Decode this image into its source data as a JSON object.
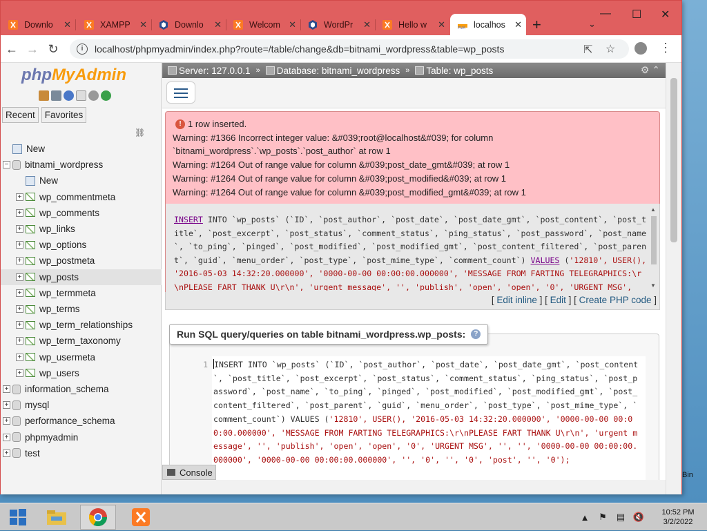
{
  "window": {
    "tabs": [
      {
        "label": "Downlo",
        "icon": "xampp-icon"
      },
      {
        "label": "XAMPP",
        "icon": "xampp-icon"
      },
      {
        "label": "Downlo",
        "icon": "bitnami-icon"
      },
      {
        "label": "Welcom",
        "icon": "xampp-icon"
      },
      {
        "label": "WordPr",
        "icon": "bitnami-icon"
      },
      {
        "label": "Hello w",
        "icon": "xampp-icon"
      },
      {
        "label": "localhos",
        "icon": "pma-icon",
        "active": true
      }
    ],
    "new_tab": "+",
    "minimize": "—",
    "maximize": "☐",
    "close": "✕"
  },
  "address": {
    "url": "localhost/phpmyadmin/index.php?route=/table/change&db=bitnami_wordpress&table=wp_posts"
  },
  "nav": {
    "logo_php": "php",
    "logo_myadmin": "MyAdmin",
    "tabs": [
      "Recent",
      "Favorites"
    ],
    "tree": [
      {
        "label": "New",
        "level": 0,
        "type": "new",
        "expander": ""
      },
      {
        "label": "bitnami_wordpress",
        "level": 0,
        "type": "db",
        "expander": "−"
      },
      {
        "label": "New",
        "level": 1,
        "type": "new",
        "expander": ""
      },
      {
        "label": "wp_commentmeta",
        "level": 1,
        "type": "table",
        "expander": "+"
      },
      {
        "label": "wp_comments",
        "level": 1,
        "type": "table",
        "expander": "+"
      },
      {
        "label": "wp_links",
        "level": 1,
        "type": "table",
        "expander": "+"
      },
      {
        "label": "wp_options",
        "level": 1,
        "type": "table",
        "expander": "+"
      },
      {
        "label": "wp_postmeta",
        "level": 1,
        "type": "table",
        "expander": "+"
      },
      {
        "label": "wp_posts",
        "level": 1,
        "type": "table",
        "expander": "+",
        "selected": true
      },
      {
        "label": "wp_termmeta",
        "level": 1,
        "type": "table",
        "expander": "+"
      },
      {
        "label": "wp_terms",
        "level": 1,
        "type": "table",
        "expander": "+"
      },
      {
        "label": "wp_term_relationships",
        "level": 1,
        "type": "table",
        "expander": "+"
      },
      {
        "label": "wp_term_taxonomy",
        "level": 1,
        "type": "table",
        "expander": "+"
      },
      {
        "label": "wp_usermeta",
        "level": 1,
        "type": "table",
        "expander": "+"
      },
      {
        "label": "wp_users",
        "level": 1,
        "type": "table",
        "expander": "+"
      },
      {
        "label": "information_schema",
        "level": 0,
        "type": "db",
        "expander": "+"
      },
      {
        "label": "mysql",
        "level": 0,
        "type": "db",
        "expander": "+"
      },
      {
        "label": "performance_schema",
        "level": 0,
        "type": "db",
        "expander": "+"
      },
      {
        "label": "phpmyadmin",
        "level": 0,
        "type": "db",
        "expander": "+"
      },
      {
        "label": "test",
        "level": 0,
        "type": "db",
        "expander": "+"
      }
    ]
  },
  "breadcrumb": {
    "server": "Server: 127.0.0.1",
    "database": "Database: bitnami_wordpress",
    "table": "Table: wp_posts",
    "sep": "»"
  },
  "alert": {
    "lines": [
      "1 row inserted.",
      "Warning: #1366 Incorrect integer value: &#039;root@localhost&#039; for column",
      "`bitnami_wordpress`.`wp_posts`.`post_author` at row 1",
      "Warning: #1264 Out of range value for column &#039;post_date_gmt&#039; at row 1",
      "Warning: #1264 Out of range value for column &#039;post_modified&#039; at row 1",
      "Warning: #1264 Out of range value for column &#039;post_modified_gmt&#039; at row 1"
    ]
  },
  "sql": {
    "keyword_insert": "INSERT",
    "part1": " INTO `wp_posts` (`ID`, `post_author`, `post_date`, `post_date_gmt`, `post_content`, `post_title`, `post_excerpt`, `post_status`, `comment_status`, `ping_status`, `post_password`, `post_name`, `to_ping`, `pinged`, `post_modified`, `post_modified_gmt`, `post_content_filtered`, `post_parent`, `guid`, `menu_order`, `post_type`, `post_mime_type`, `comment_count`) ",
    "keyword_values": "VALUES",
    "part2": " (",
    "values_text": "'12810', USER(), '2016-05-03 14:32:20.000000', '0000-00-00 00:00:00.000000', 'MESSAGE FROM FARTING TELEGRAPHICS:\\r\\nPLEASE FART THANK U\\r\\n', 'urgent message', '', 'publish', 'open', 'open', '0', 'URGENT MSG', '', '', '0000-00-00 00:00:00.000000', '0000-00-00 00:00:00.000000', '', '0', '', '0', 'post', '', '0');",
    "links": {
      "open": "[ ",
      "edit_inline": "Edit inline",
      "mid1": " ] [ ",
      "edit": "Edit",
      "mid2": " ] [ ",
      "create_php": "Create PHP code",
      "close": " ]"
    }
  },
  "run_sql": {
    "title_prefix": "Run SQL query/queries on table ",
    "table": "bitnami_wordpress.wp_posts:",
    "help": "?",
    "line_number": "1",
    "code_before": "INSERT INTO `wp_posts` (`ID`, `post_author`, `post_date`, `post_date_gmt`, `post_content`, `post_title`, `post_excerpt`, `post_status`, `comment_status`, `ping_status`, `post_password`, `post_name`, `to_ping`, `pinged`, `post_modified`, `post_modified_gmt`, `post_content_filtered`, `post_parent`, `guid`, `menu_order`, `post_type`, `post_mime_type`, `comment_count`) VALUES (",
    "code_values": "'12810', USER(), '2016-05-03 14:32:20.000000', '0000-00-00 00:00:00.000000', 'MESSAGE FROM FARTING TELEGRAPHICS:\\r\\nPLEASE FART THANK U\\r\\n', 'urgent message', '', 'publish', 'open', 'open', '0', 'URGENT MSG', '', '', '0000-00-00 00:00:00.000000', '0000-00-00 00:00:00.000000', '', '0', '', '0', 'post', '', '0');"
  },
  "console": {
    "label": "Console"
  },
  "desktop": {
    "recycle_label": "Bin"
  },
  "taskbar": {
    "time": "10:52 PM",
    "date": "3/2/2022"
  },
  "colors": {
    "titlebar": "#e05f5f",
    "alert_bg": "#ffc0c6",
    "link": "#235a81"
  }
}
